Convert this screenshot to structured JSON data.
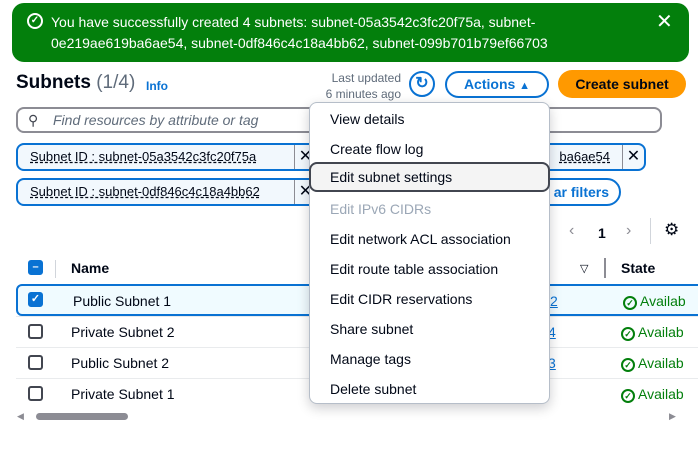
{
  "flash": {
    "message": "You have successfully created 4 subnets: subnet-05a3542c3fc20f75a, subnet-0e219ae619ba6ae54, subnet-0df846c4c18a4bb62, subnet-099b701b79ef66703",
    "icon": "success-check-icon",
    "color": "#037f0c"
  },
  "header": {
    "title": "Subnets",
    "count": "(1/4)",
    "info": "Info",
    "last_updated_1": "Last updated",
    "last_updated_2": "6 minutes ago",
    "actions": "Actions",
    "create": "Create subnet"
  },
  "search": {
    "placeholder": "Find resources by attribute or tag"
  },
  "filters": [
    {
      "label": "Subnet ID : subnet-05a3542c3fc20f75a"
    },
    {
      "label": "ba6ae54"
    },
    {
      "label": "Subnet ID : subnet-0df846c4c18a4bb62"
    }
  ],
  "clear_filters": "ar filters",
  "pagination": {
    "page": "1"
  },
  "table": {
    "columns": [
      "Name",
      "State"
    ],
    "rows": [
      {
        "name": "Public Subnet 1",
        "link": "2",
        "state": "Availab",
        "selected": true
      },
      {
        "name": "Private Subnet 2",
        "link": "4",
        "state": "Availab",
        "selected": false
      },
      {
        "name": "Public Subnet 2",
        "link": "3",
        "state": "Availab",
        "selected": false
      },
      {
        "name": "Private Subnet 1",
        "link": "",
        "state": "Availab",
        "selected": false
      }
    ]
  },
  "menu": {
    "items": [
      "View details",
      "Create flow log",
      "Edit subnet settings",
      "Edit IPv6 CIDRs",
      "Edit network ACL association",
      "Edit route table association",
      "Edit CIDR reservations",
      "Share subnet",
      "Manage tags",
      "Delete subnet"
    ],
    "highlighted": "Edit subnet settings",
    "disabled": "Edit IPv6 CIDRs"
  }
}
